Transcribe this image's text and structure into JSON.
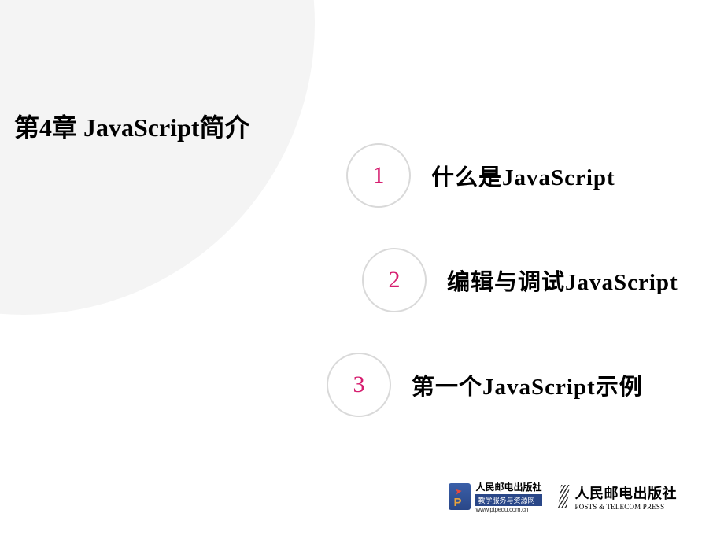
{
  "title": "第4章 JavaScript简介",
  "items": [
    {
      "num": "1",
      "text": "什么是JavaScript"
    },
    {
      "num": "2",
      "text": "编辑与调试JavaScript"
    },
    {
      "num": "3",
      "text": "第一个JavaScript示例"
    }
  ],
  "footer": {
    "logo1": {
      "line1": "人民邮电出版社",
      "line2": "教学服务与资源网",
      "url": "www.ptpedu.com.cn",
      "letter": "P"
    },
    "logo2": {
      "line1": "人民邮电出版社",
      "line2": "POSTS & TELECOM PRESS"
    }
  }
}
